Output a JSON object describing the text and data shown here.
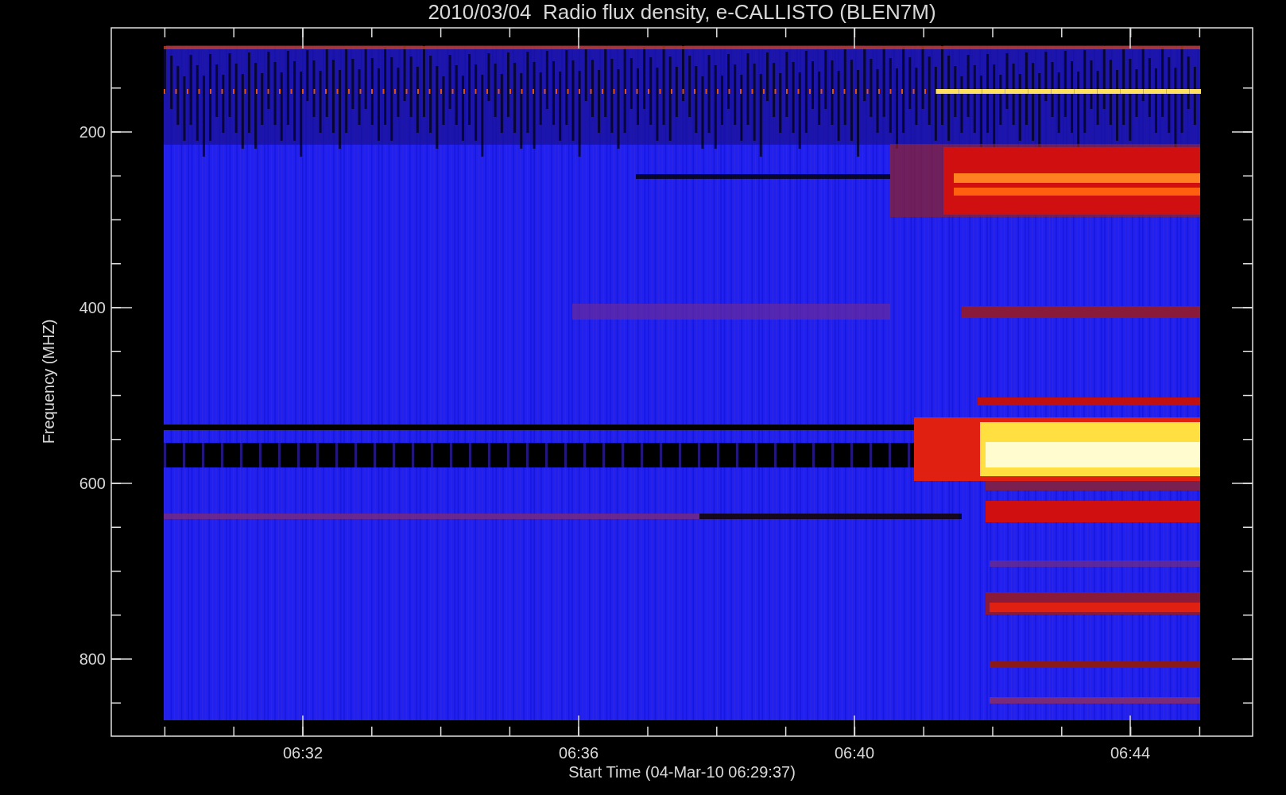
{
  "title": "2010/03/04  Radio flux density, e-CALLISTO (BLEN7M)",
  "chart": {
    "xlabel": "Start Time (04-Mar-10 06:29:37)",
    "ylabel": "Frequency (MHZ)",
    "xticks": [
      {
        "label": "06:32"
      },
      {
        "label": "06:36"
      },
      {
        "label": "06:40"
      },
      {
        "label": "06:44"
      }
    ],
    "yticks": [
      {
        "label": "200"
      },
      {
        "label": "400"
      },
      {
        "label": "600"
      },
      {
        "label": "800"
      }
    ]
  }
}
